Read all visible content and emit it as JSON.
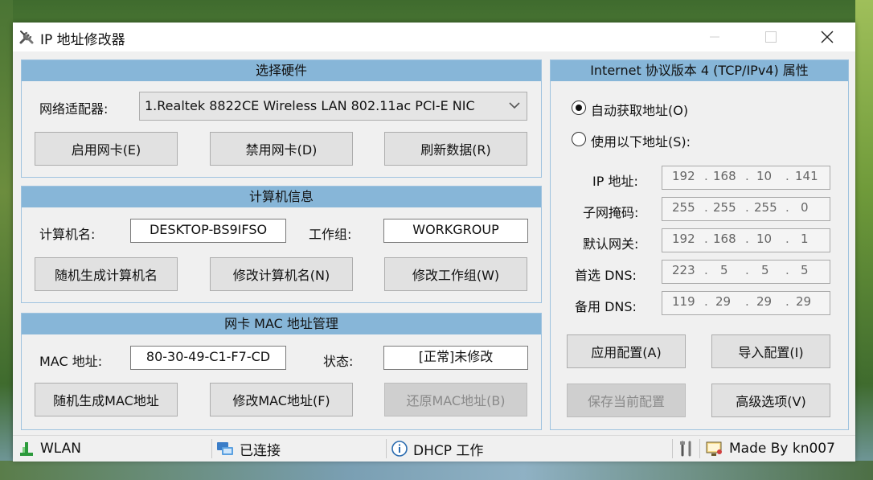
{
  "window": {
    "title": "IP 地址修改器",
    "min_icon": "minimize-icon",
    "max_icon": "maximize-icon",
    "close_icon": "close-icon"
  },
  "hardware": {
    "header": "选择硬件",
    "adapter_label": "网络适配器:",
    "adapter_value": "1.Realtek 8822CE Wireless LAN 802.11ac PCI-E NIC",
    "enable_btn": "启用网卡(E)",
    "disable_btn": "禁用网卡(D)",
    "refresh_btn": "刷新数据(R)"
  },
  "computer": {
    "header": "计算机信息",
    "name_label": "计算机名:",
    "name_value": "DESKTOP-BS9IFSO",
    "workgroup_label": "工作组:",
    "workgroup_value": "WORKGROUP",
    "random_name_btn": "随机生成计算机名",
    "modify_name_btn": "修改计算机名(N)",
    "modify_group_btn": "修改工作组(W)"
  },
  "mac": {
    "header": "网卡 MAC 地址管理",
    "mac_label": "MAC 地址:",
    "mac_value": "80-30-49-C1-F7-CD",
    "state_label": "状态:",
    "state_value": "[正常]未修改",
    "random_mac_btn": "随机生成MAC地址",
    "modify_mac_btn": "修改MAC地址(F)",
    "restore_mac_btn": "还原MAC地址(B)"
  },
  "ipv4": {
    "header": "Internet 协议版本 4 (TCP/IPv4) 属性",
    "auto_radio": "自动获取地址(O)",
    "manual_radio": "使用以下地址(S):",
    "selected": "auto",
    "ip_label": "IP 地址:",
    "ip": [
      "192",
      "168",
      "10",
      "141"
    ],
    "mask_label": "子网掩码:",
    "mask": [
      "255",
      "255",
      "255",
      "0"
    ],
    "gateway_label": "默认网关:",
    "gateway": [
      "192",
      "168",
      "10",
      "1"
    ],
    "dns1_label": "首选 DNS:",
    "dns1": [
      "223",
      "5",
      "5",
      "5"
    ],
    "dns2_label": "备用 DNS:",
    "dns2": [
      "119",
      "29",
      "29",
      "29"
    ],
    "apply_btn": "应用配置(A)",
    "import_btn": "导入配置(I)",
    "save_btn": "保存当前配置",
    "advanced_btn": "高级选项(V)"
  },
  "status": {
    "wlan": "WLAN",
    "connected": "已连接",
    "dhcp": "DHCP 工作",
    "credit": "Made By kn007"
  },
  "colors": {
    "panel_header": "#87b6d8",
    "panel_border": "#9fc3df"
  }
}
